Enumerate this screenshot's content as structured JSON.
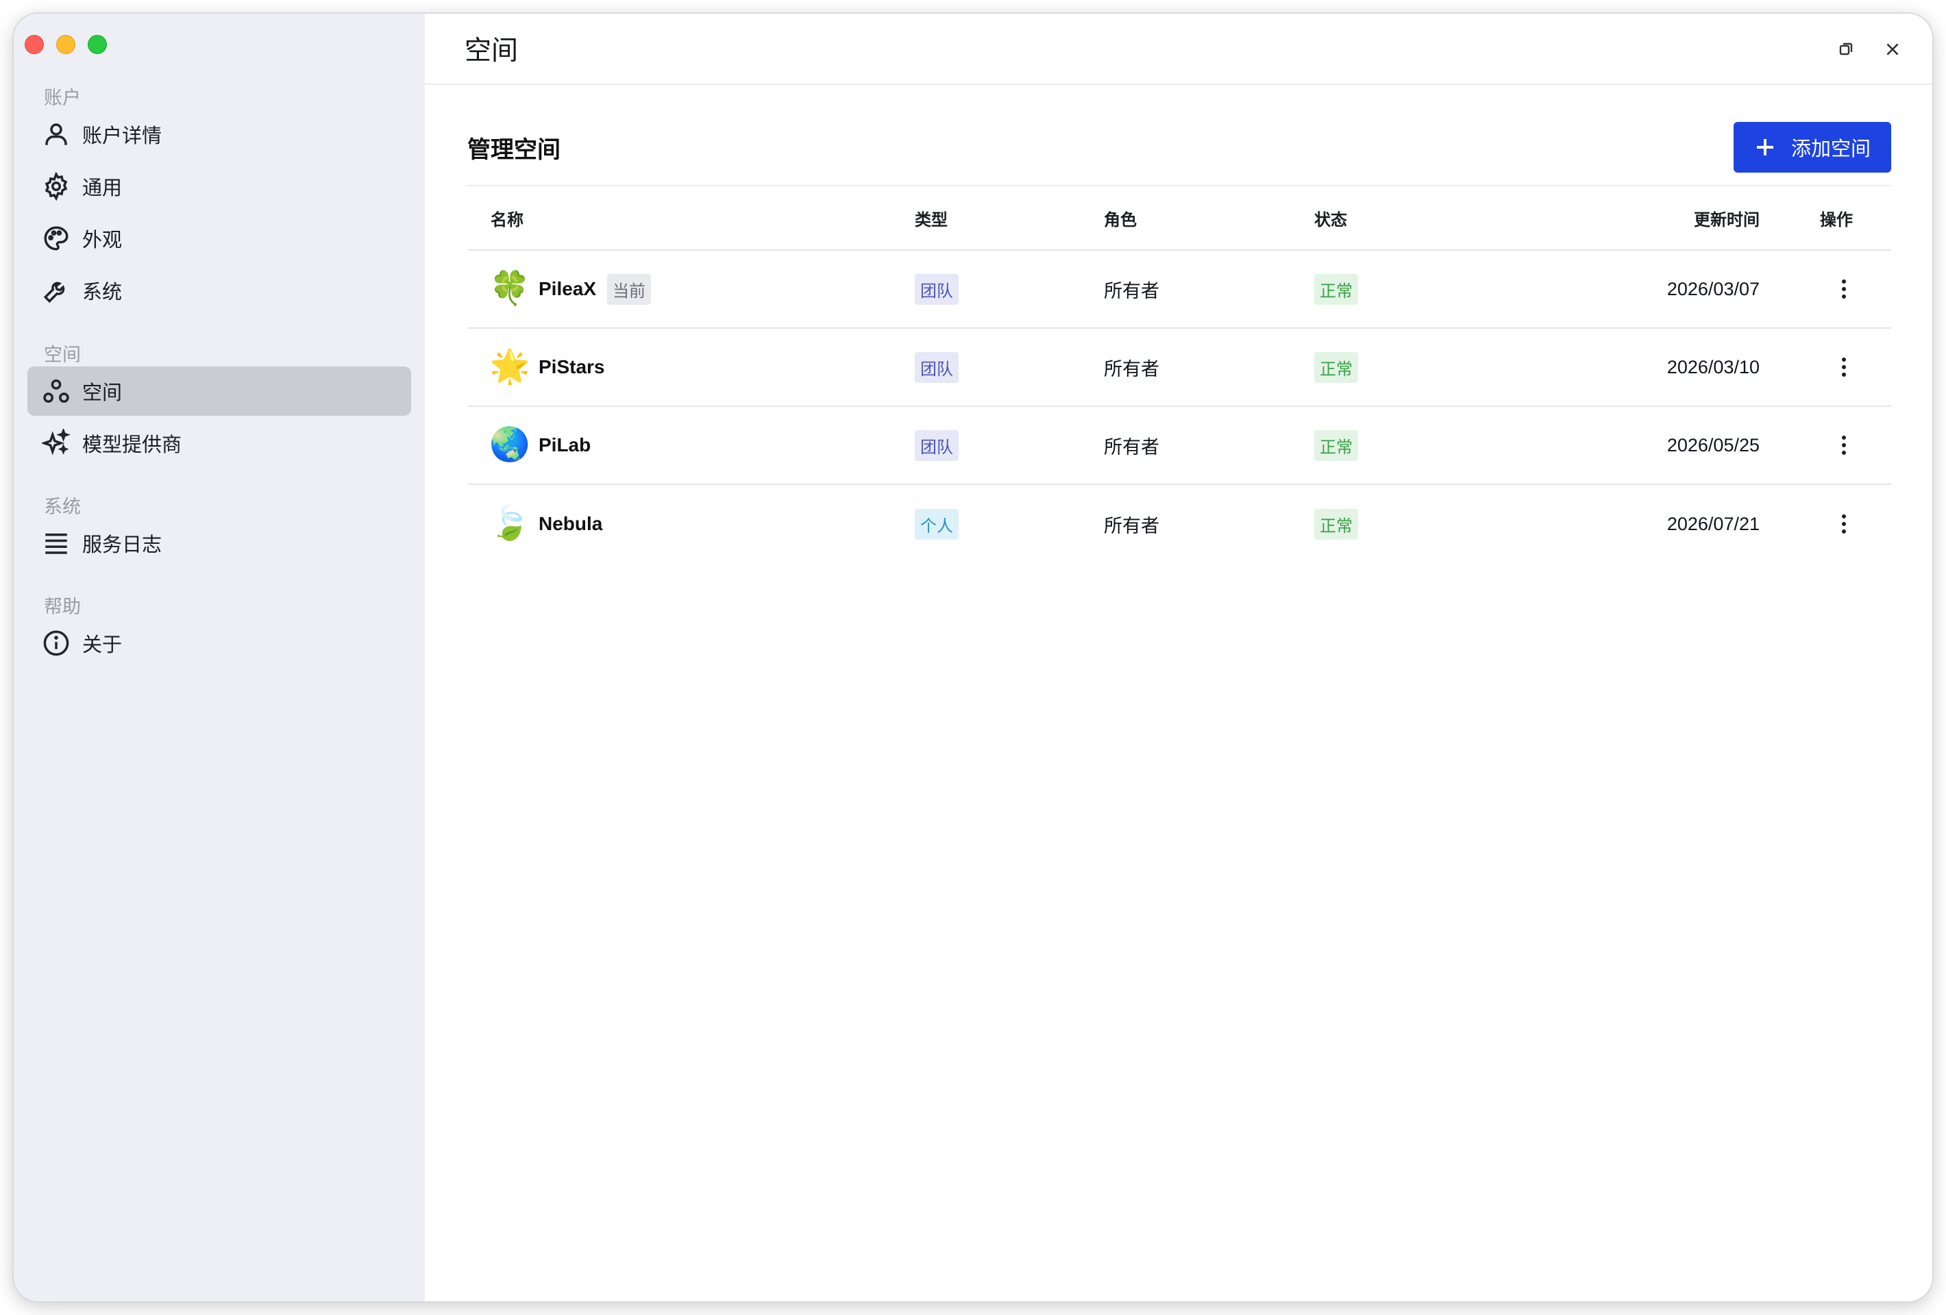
{
  "window": {
    "controls": [
      "close",
      "minimize",
      "zoom"
    ]
  },
  "sidebar": {
    "groups": [
      {
        "label": "账户",
        "items": [
          {
            "label": "账户详情",
            "icon": "user-icon"
          },
          {
            "label": "通用",
            "icon": "gear-icon"
          },
          {
            "label": "外观",
            "icon": "palette-icon"
          },
          {
            "label": "系统",
            "icon": "wrench-icon"
          }
        ]
      },
      {
        "label": "空间",
        "items": [
          {
            "label": "空间",
            "icon": "spaces-icon",
            "active": true
          },
          {
            "label": "模型提供商",
            "icon": "sparkles-icon"
          }
        ]
      },
      {
        "label": "系统",
        "items": [
          {
            "label": "服务日志",
            "icon": "list-icon"
          }
        ]
      },
      {
        "label": "帮助",
        "items": [
          {
            "label": "关于",
            "icon": "info-icon"
          }
        ]
      }
    ]
  },
  "header": {
    "title": "空间"
  },
  "section": {
    "title": "管理空间",
    "add_button_label": "添加空间"
  },
  "table": {
    "columns": {
      "name": "名称",
      "type": "类型",
      "role": "角色",
      "status": "状态",
      "updated": "更新时间",
      "ops": "操作"
    },
    "rows": [
      {
        "icon": "🍀",
        "name": "PileaX",
        "badge": "当前",
        "type": "团队",
        "type_kind": "team",
        "role": "所有者",
        "status": "正常",
        "updated": "2026/03/07"
      },
      {
        "icon": "🌟",
        "name": "PiStars",
        "badge": "",
        "type": "团队",
        "type_kind": "team",
        "role": "所有者",
        "status": "正常",
        "updated": "2026/03/10"
      },
      {
        "icon": "🌏",
        "name": "PiLab",
        "badge": "",
        "type": "团队",
        "type_kind": "team",
        "role": "所有者",
        "status": "正常",
        "updated": "2026/05/25"
      },
      {
        "icon": "🍃",
        "name": "Nebula",
        "badge": "",
        "type": "个人",
        "type_kind": "personal",
        "role": "所有者",
        "status": "正常",
        "updated": "2026/07/21"
      }
    ]
  },
  "colors": {
    "accent": "#1d43e0",
    "sidebar_bg": "#eeeff4",
    "active_item": "#cbccd2"
  }
}
